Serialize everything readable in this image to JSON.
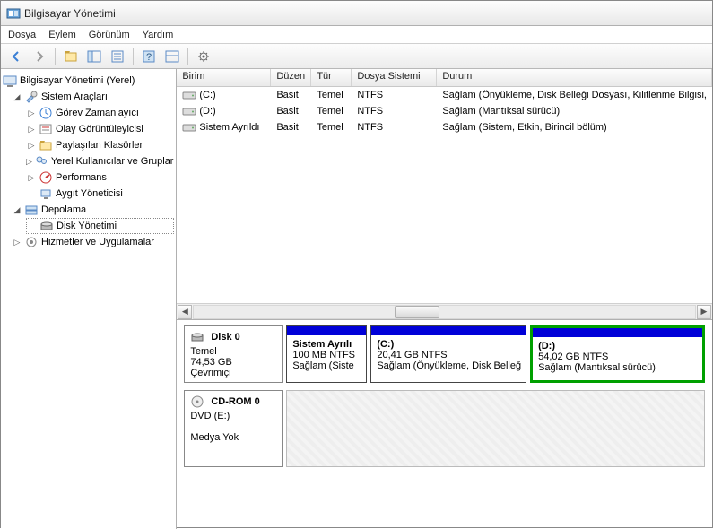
{
  "window": {
    "title": "Bilgisayar Yönetimi"
  },
  "menu": {
    "file": "Dosya",
    "action": "Eylem",
    "view": "Görünüm",
    "help": "Yardım"
  },
  "tree": {
    "root": "Bilgisayar Yönetimi (Yerel)",
    "system_tools": "Sistem Araçları",
    "task_scheduler": "Görev Zamanlayıcı",
    "event_viewer": "Olay Görüntüleyicisi",
    "shared_folders": "Paylaşılan Klasörler",
    "local_users": "Yerel Kullanıcılar ve Gruplar",
    "performance": "Performans",
    "device_manager": "Aygıt Yöneticisi",
    "storage": "Depolama",
    "disk_management": "Disk Yönetimi",
    "services": "Hizmetler ve Uygulamalar"
  },
  "volumes": {
    "headers": {
      "volume": "Birim",
      "layout": "Düzen",
      "type": "Tür",
      "fs": "Dosya Sistemi",
      "status": "Durum"
    },
    "rows": [
      {
        "name": "(C:)",
        "layout": "Basit",
        "type": "Temel",
        "fs": "NTFS",
        "status": "Sağlam (Önyükleme, Disk Belleği Dosyası, Kilitlenme Bilgisi,"
      },
      {
        "name": "(D:)",
        "layout": "Basit",
        "type": "Temel",
        "fs": "NTFS",
        "status": "Sağlam (Mantıksal sürücü)"
      },
      {
        "name": "Sistem Ayrıldı",
        "layout": "Basit",
        "type": "Temel",
        "fs": "NTFS",
        "status": "Sağlam (Sistem, Etkin, Birincil bölüm)"
      }
    ]
  },
  "disks": {
    "d0": {
      "label": "Disk 0",
      "type": "Temel",
      "size": "74,53 GB",
      "status": "Çevrimiçi",
      "p1": {
        "name": "Sistem Ayrılı",
        "size": "100 MB NTFS",
        "status": "Sağlam (Siste"
      },
      "p2": {
        "name": "(C:)",
        "size": "20,41 GB NTFS",
        "status": "Sağlam (Önyükleme, Disk Belleğ"
      },
      "p3": {
        "name": "(D:)",
        "size": "54,02 GB NTFS",
        "status": "Sağlam (Mantıksal sürücü)"
      }
    },
    "cd": {
      "label": "CD-ROM 0",
      "type": "DVD (E:)",
      "status": "Medya Yok"
    }
  },
  "colors": {
    "primary_header": "#0000d8",
    "selected_border": "#00a000"
  }
}
